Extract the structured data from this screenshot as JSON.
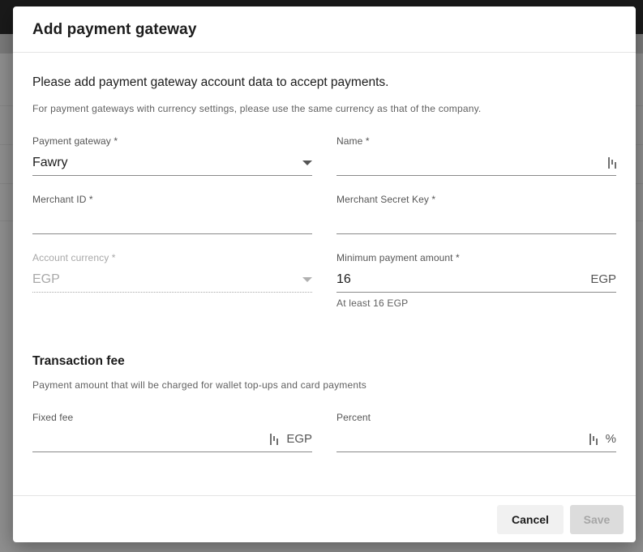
{
  "dialog": {
    "title": "Add payment gateway",
    "intro": "Please add payment gateway account data to accept payments.",
    "currency_note": "For payment gateways with currency settings, please use the same currency as that of the company."
  },
  "fields": {
    "payment_gateway": {
      "label": "Payment gateway *",
      "value": "Fawry",
      "icon": "chevron-down-icon"
    },
    "name": {
      "label": "Name *",
      "value": "",
      "icon": "key-icon"
    },
    "merchant_id": {
      "label": "Merchant ID *",
      "value": ""
    },
    "merchant_secret_key": {
      "label": "Merchant Secret Key *",
      "value": ""
    },
    "account_currency": {
      "label": "Account currency *",
      "value": "EGP",
      "disabled": true,
      "icon": "chevron-down-icon"
    },
    "minimum_payment_amount": {
      "label": "Minimum payment amount *",
      "value": "16",
      "suffix": "EGP",
      "helper": "At least 16 EGP"
    }
  },
  "transaction_fee": {
    "title": "Transaction fee",
    "note": "Payment amount that will be charged for wallet top-ups and card payments",
    "fixed_fee": {
      "label": "Fixed fee",
      "value": "",
      "suffix": "EGP",
      "icon": "key-icon"
    },
    "percent": {
      "label": "Percent",
      "value": "",
      "suffix": "%",
      "icon": "key-icon"
    }
  },
  "footer": {
    "cancel_label": "Cancel",
    "save_label": "Save"
  },
  "colors": {
    "primary_text": "#1c1c1c",
    "secondary_text": "#606060",
    "disabled_text": "#a8a8a8",
    "save_disabled_bg": "#dcdcdc",
    "cancel_bg": "#f1f1f1"
  }
}
